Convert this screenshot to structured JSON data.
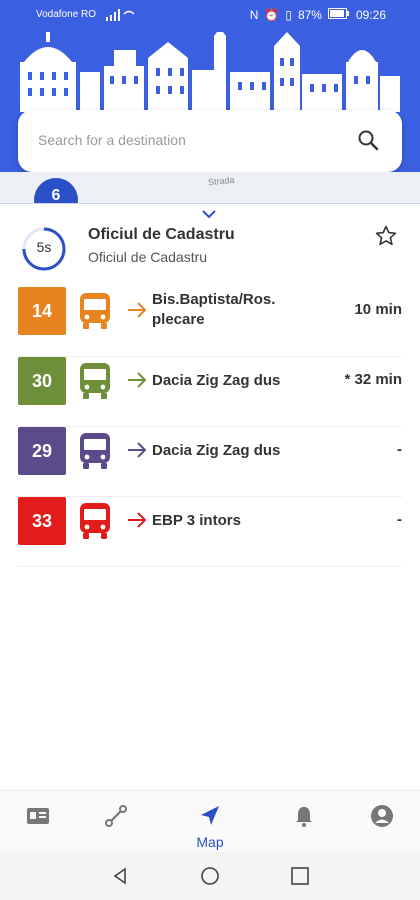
{
  "status_bar": {
    "carrier": "Vodafone RO",
    "battery": "87%",
    "time": "09:26"
  },
  "search": {
    "placeholder": "Search for a destination"
  },
  "map": {
    "stop_badge": "6",
    "street": "Strada"
  },
  "stop": {
    "refresh": "5s",
    "title": "Oficiul de Cadastru",
    "subtitle": "Oficiul de Cadastru"
  },
  "routes": [
    {
      "number": "14",
      "color": "#e8841f",
      "destination": "Bis.Baptista/Ros. plecare",
      "eta": "10 min"
    },
    {
      "number": "30",
      "color": "#6e8f3a",
      "destination": "Dacia Zig Zag dus",
      "eta": "* 32 min"
    },
    {
      "number": "29",
      "color": "#5b4b8a",
      "destination": "Dacia Zig Zag dus",
      "eta": "-"
    },
    {
      "number": "33",
      "color": "#e21b1b",
      "destination": "EBP 3 intors",
      "eta": "-"
    }
  ],
  "nav": {
    "active_label": "Map",
    "items": [
      "id-card-icon",
      "route-icon",
      "navigation-arrow-icon",
      "bell-icon",
      "account-icon"
    ]
  },
  "colors": {
    "header": "#3a5fe0",
    "accent": "#2b4fc6"
  }
}
